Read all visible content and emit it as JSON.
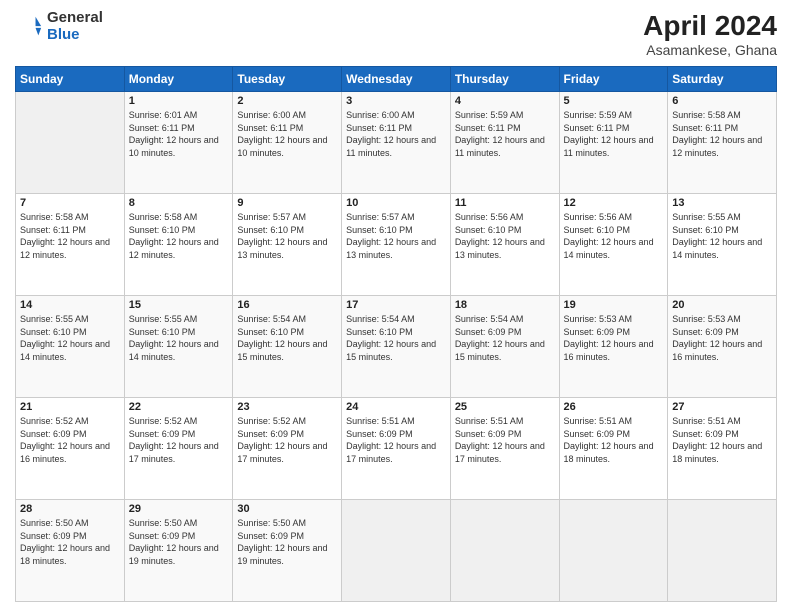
{
  "logo": {
    "general": "General",
    "blue": "Blue"
  },
  "header": {
    "title": "April 2024",
    "location": "Asamankese, Ghana"
  },
  "columns": [
    "Sunday",
    "Monday",
    "Tuesday",
    "Wednesday",
    "Thursday",
    "Friday",
    "Saturday"
  ],
  "weeks": [
    [
      {
        "day": "",
        "sunrise": "",
        "sunset": "",
        "daylight": ""
      },
      {
        "day": "1",
        "sunrise": "Sunrise: 6:01 AM",
        "sunset": "Sunset: 6:11 PM",
        "daylight": "Daylight: 12 hours and 10 minutes."
      },
      {
        "day": "2",
        "sunrise": "Sunrise: 6:00 AM",
        "sunset": "Sunset: 6:11 PM",
        "daylight": "Daylight: 12 hours and 10 minutes."
      },
      {
        "day": "3",
        "sunrise": "Sunrise: 6:00 AM",
        "sunset": "Sunset: 6:11 PM",
        "daylight": "Daylight: 12 hours and 11 minutes."
      },
      {
        "day": "4",
        "sunrise": "Sunrise: 5:59 AM",
        "sunset": "Sunset: 6:11 PM",
        "daylight": "Daylight: 12 hours and 11 minutes."
      },
      {
        "day": "5",
        "sunrise": "Sunrise: 5:59 AM",
        "sunset": "Sunset: 6:11 PM",
        "daylight": "Daylight: 12 hours and 11 minutes."
      },
      {
        "day": "6",
        "sunrise": "Sunrise: 5:58 AM",
        "sunset": "Sunset: 6:11 PM",
        "daylight": "Daylight: 12 hours and 12 minutes."
      }
    ],
    [
      {
        "day": "7",
        "sunrise": "Sunrise: 5:58 AM",
        "sunset": "Sunset: 6:11 PM",
        "daylight": "Daylight: 12 hours and 12 minutes."
      },
      {
        "day": "8",
        "sunrise": "Sunrise: 5:58 AM",
        "sunset": "Sunset: 6:10 PM",
        "daylight": "Daylight: 12 hours and 12 minutes."
      },
      {
        "day": "9",
        "sunrise": "Sunrise: 5:57 AM",
        "sunset": "Sunset: 6:10 PM",
        "daylight": "Daylight: 12 hours and 13 minutes."
      },
      {
        "day": "10",
        "sunrise": "Sunrise: 5:57 AM",
        "sunset": "Sunset: 6:10 PM",
        "daylight": "Daylight: 12 hours and 13 minutes."
      },
      {
        "day": "11",
        "sunrise": "Sunrise: 5:56 AM",
        "sunset": "Sunset: 6:10 PM",
        "daylight": "Daylight: 12 hours and 13 minutes."
      },
      {
        "day": "12",
        "sunrise": "Sunrise: 5:56 AM",
        "sunset": "Sunset: 6:10 PM",
        "daylight": "Daylight: 12 hours and 14 minutes."
      },
      {
        "day": "13",
        "sunrise": "Sunrise: 5:55 AM",
        "sunset": "Sunset: 6:10 PM",
        "daylight": "Daylight: 12 hours and 14 minutes."
      }
    ],
    [
      {
        "day": "14",
        "sunrise": "Sunrise: 5:55 AM",
        "sunset": "Sunset: 6:10 PM",
        "daylight": "Daylight: 12 hours and 14 minutes."
      },
      {
        "day": "15",
        "sunrise": "Sunrise: 5:55 AM",
        "sunset": "Sunset: 6:10 PM",
        "daylight": "Daylight: 12 hours and 14 minutes."
      },
      {
        "day": "16",
        "sunrise": "Sunrise: 5:54 AM",
        "sunset": "Sunset: 6:10 PM",
        "daylight": "Daylight: 12 hours and 15 minutes."
      },
      {
        "day": "17",
        "sunrise": "Sunrise: 5:54 AM",
        "sunset": "Sunset: 6:10 PM",
        "daylight": "Daylight: 12 hours and 15 minutes."
      },
      {
        "day": "18",
        "sunrise": "Sunrise: 5:54 AM",
        "sunset": "Sunset: 6:09 PM",
        "daylight": "Daylight: 12 hours and 15 minutes."
      },
      {
        "day": "19",
        "sunrise": "Sunrise: 5:53 AM",
        "sunset": "Sunset: 6:09 PM",
        "daylight": "Daylight: 12 hours and 16 minutes."
      },
      {
        "day": "20",
        "sunrise": "Sunrise: 5:53 AM",
        "sunset": "Sunset: 6:09 PM",
        "daylight": "Daylight: 12 hours and 16 minutes."
      }
    ],
    [
      {
        "day": "21",
        "sunrise": "Sunrise: 5:52 AM",
        "sunset": "Sunset: 6:09 PM",
        "daylight": "Daylight: 12 hours and 16 minutes."
      },
      {
        "day": "22",
        "sunrise": "Sunrise: 5:52 AM",
        "sunset": "Sunset: 6:09 PM",
        "daylight": "Daylight: 12 hours and 17 minutes."
      },
      {
        "day": "23",
        "sunrise": "Sunrise: 5:52 AM",
        "sunset": "Sunset: 6:09 PM",
        "daylight": "Daylight: 12 hours and 17 minutes."
      },
      {
        "day": "24",
        "sunrise": "Sunrise: 5:51 AM",
        "sunset": "Sunset: 6:09 PM",
        "daylight": "Daylight: 12 hours and 17 minutes."
      },
      {
        "day": "25",
        "sunrise": "Sunrise: 5:51 AM",
        "sunset": "Sunset: 6:09 PM",
        "daylight": "Daylight: 12 hours and 17 minutes."
      },
      {
        "day": "26",
        "sunrise": "Sunrise: 5:51 AM",
        "sunset": "Sunset: 6:09 PM",
        "daylight": "Daylight: 12 hours and 18 minutes."
      },
      {
        "day": "27",
        "sunrise": "Sunrise: 5:51 AM",
        "sunset": "Sunset: 6:09 PM",
        "daylight": "Daylight: 12 hours and 18 minutes."
      }
    ],
    [
      {
        "day": "28",
        "sunrise": "Sunrise: 5:50 AM",
        "sunset": "Sunset: 6:09 PM",
        "daylight": "Daylight: 12 hours and 18 minutes."
      },
      {
        "day": "29",
        "sunrise": "Sunrise: 5:50 AM",
        "sunset": "Sunset: 6:09 PM",
        "daylight": "Daylight: 12 hours and 19 minutes."
      },
      {
        "day": "30",
        "sunrise": "Sunrise: 5:50 AM",
        "sunset": "Sunset: 6:09 PM",
        "daylight": "Daylight: 12 hours and 19 minutes."
      },
      {
        "day": "",
        "sunrise": "",
        "sunset": "",
        "daylight": ""
      },
      {
        "day": "",
        "sunrise": "",
        "sunset": "",
        "daylight": ""
      },
      {
        "day": "",
        "sunrise": "",
        "sunset": "",
        "daylight": ""
      },
      {
        "day": "",
        "sunrise": "",
        "sunset": "",
        "daylight": ""
      }
    ]
  ]
}
